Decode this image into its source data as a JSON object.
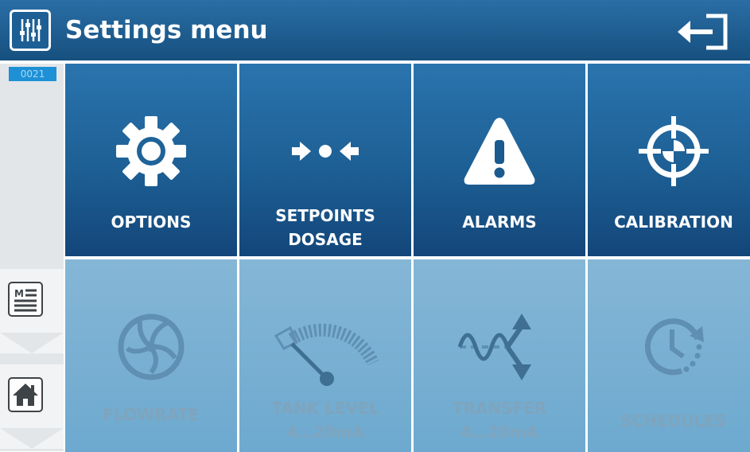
{
  "header": {
    "title": "Settings menu",
    "app_icon": "mixer-sliders-icon",
    "exit_icon": "exit-arrow-icon"
  },
  "rail": {
    "counter": "0021",
    "buttons": [
      {
        "icon": "menu-list-icon"
      },
      {
        "icon": "home-icon"
      }
    ]
  },
  "tiles": [
    {
      "label1": "OPTIONS",
      "label2": "",
      "icon": "gear-icon",
      "enabled": true
    },
    {
      "label1": "SETPOINTS",
      "label2": "DOSAGE",
      "icon": "setpoint-arrows-icon",
      "enabled": true
    },
    {
      "label1": "ALARMS",
      "label2": "",
      "icon": "warning-icon",
      "enabled": true
    },
    {
      "label1": "CALIBRATION",
      "label2": "",
      "icon": "crosshair-icon",
      "enabled": true
    },
    {
      "label1": "FLOWRATE",
      "label2": "",
      "icon": "pump-impeller-icon",
      "enabled": false
    },
    {
      "label1": "TANK LEVEL",
      "label2": "4…20mA",
      "icon": "gauge-icon",
      "enabled": false
    },
    {
      "label1": "TRANSFER",
      "label2": "4…20mA",
      "icon": "signal-wave-icon",
      "enabled": false
    },
    {
      "label1": "SCHEDULES",
      "label2": "",
      "icon": "clock-icon",
      "enabled": false
    }
  ],
  "colors": {
    "header": "#1d5f94",
    "tile_active": "#1d5f94",
    "tile_disabled": "#78afd3",
    "disabled_text": "#7fa4bd"
  }
}
